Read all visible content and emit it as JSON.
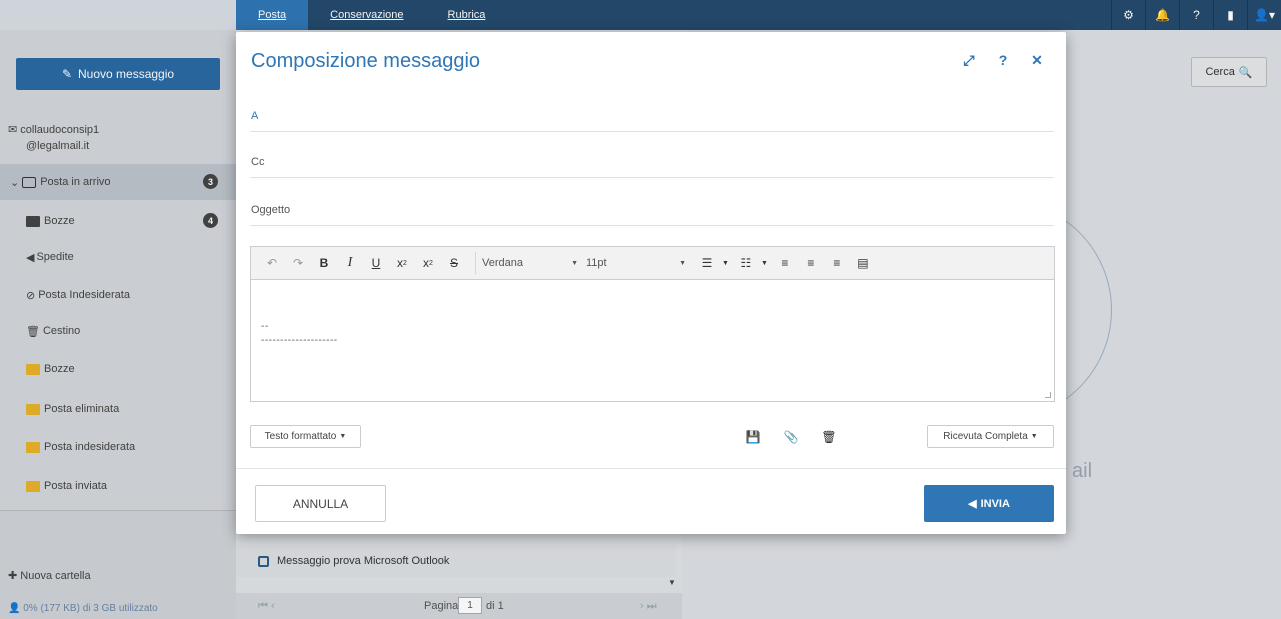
{
  "topnav": {
    "tabs": [
      {
        "label": "Posta"
      },
      {
        "label": "Conservazione"
      },
      {
        "label": "Rubrica"
      }
    ],
    "icons": [
      "gear-icon",
      "bell-icon",
      "help-icon",
      "document-icon",
      "user-icon"
    ]
  },
  "sidebar": {
    "new_message_label": "Nuovo messaggio",
    "account_line1": "collaudoconsip1",
    "account_line2": "@legalmail.it",
    "folders": [
      {
        "label": "Posta in arrivo",
        "badge": "3"
      },
      {
        "label": "Bozze",
        "badge": "4"
      },
      {
        "label": "Spedite"
      },
      {
        "label": "Posta Indesiderata"
      },
      {
        "label": "Cestino"
      },
      {
        "label": "Bozze"
      },
      {
        "label": "Posta eliminata"
      },
      {
        "label": "Posta indesiderata"
      },
      {
        "label": "Posta inviata"
      }
    ],
    "new_folder_label": "Nuova cartella",
    "quota_label": "0% (177 KB) di 3 GB utilizzato"
  },
  "list": {
    "item_subject": "Messaggio prova Microsoft Outlook",
    "pager": {
      "label": "Pagina",
      "page": "1",
      "of_label": "di 1"
    }
  },
  "reader": {
    "search_label": "Cerca",
    "partial_text": "ail"
  },
  "modal": {
    "title": "Composizione messaggio",
    "to_placeholder": "A",
    "cc_placeholder": "Cc",
    "subject_placeholder": "Oggetto",
    "editor": {
      "font": "Verdana",
      "size": "11pt",
      "signature_line1": "--",
      "signature_line2": "--------------------"
    },
    "format_label": "Testo formattato",
    "receipt_label": "Ricevuta Completa",
    "cancel_label": "ANNULLA",
    "send_label": "INVIA"
  }
}
